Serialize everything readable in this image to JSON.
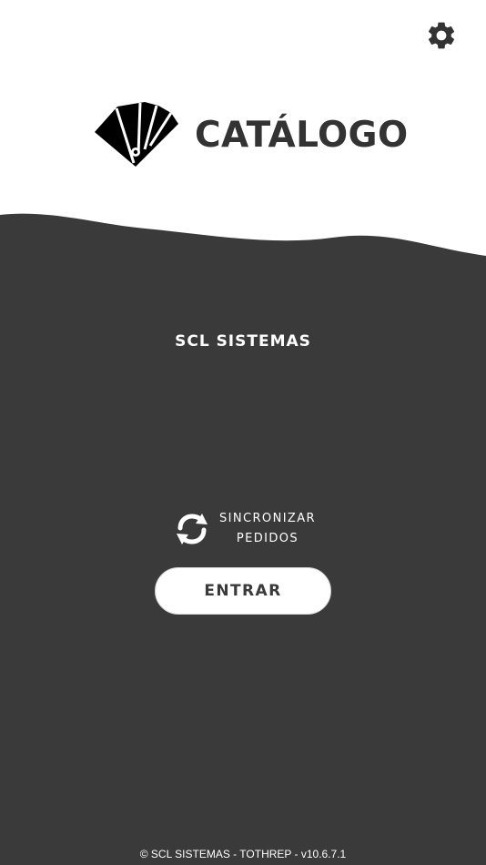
{
  "header": {
    "settings_icon": "gear-icon"
  },
  "brand": {
    "logo_icon": "tag-fan-logo-icon",
    "title": "CATÁLOGO"
  },
  "main": {
    "company_name": "SCL SISTEMAS",
    "sync": {
      "icon": "sync-icon",
      "label": "SINCRONIZAR\nPEDIDOS"
    },
    "enter_label": "ENTRAR"
  },
  "footer": {
    "copyright": "© SCL SISTEMAS - TOTHREP - v10.6.7.1"
  },
  "colors": {
    "dark_background": "#3a3a3a",
    "white_background": "#ffffff",
    "accent_text": "#333333"
  }
}
